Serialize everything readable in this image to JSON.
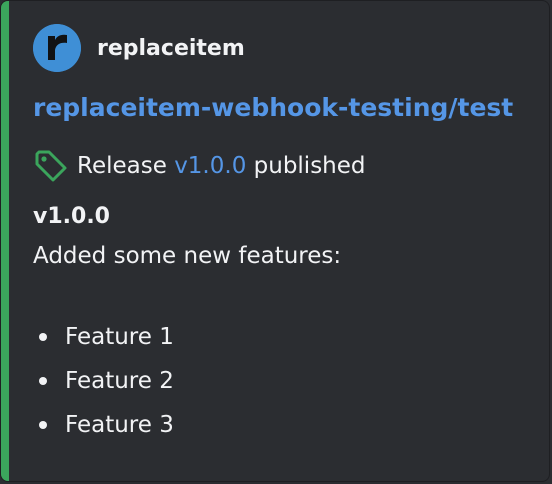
{
  "author": {
    "name": "replaceitem",
    "avatar_letter": "r"
  },
  "embed": {
    "title": "replaceitem-webhook-testing/test",
    "accent_color": "#3ba55c",
    "link_color": "#5596e6",
    "tag_icon": "tag-icon"
  },
  "release": {
    "prefix": "Release",
    "version_link": "v1.0.0",
    "suffix": "published"
  },
  "body": {
    "version_heading": "v1.0.0",
    "description": "Added some new features:",
    "features": [
      "Feature 1",
      "Feature 2",
      "Feature 3"
    ]
  }
}
